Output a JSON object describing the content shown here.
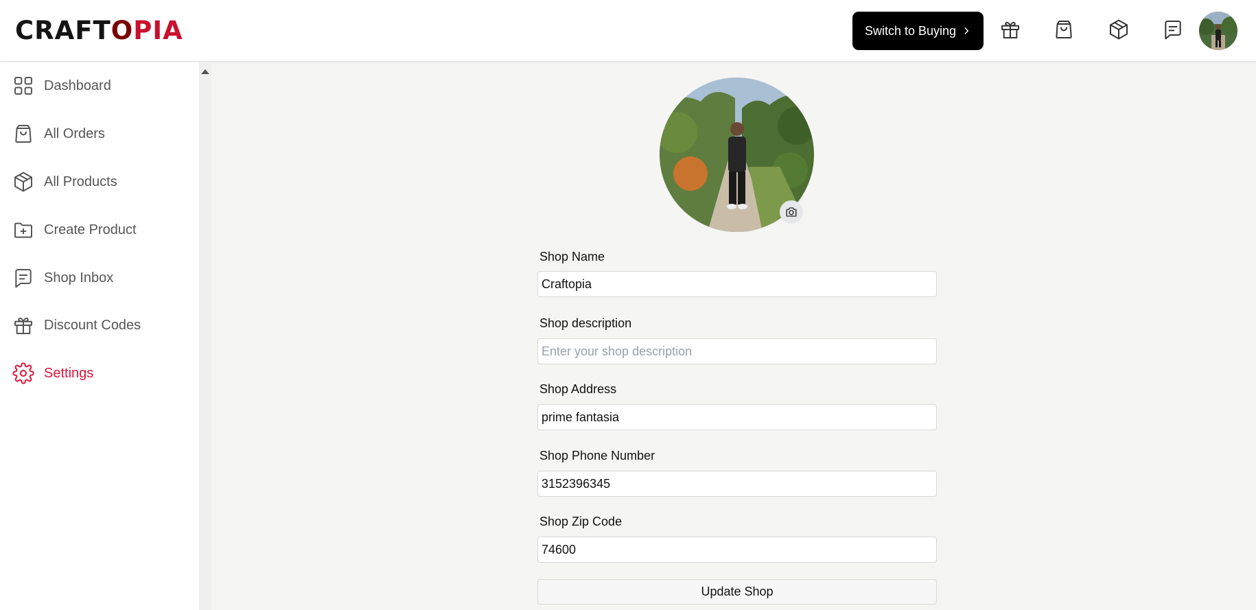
{
  "brand": {
    "logo_part1": "CRAFT",
    "logo_part2": "O",
    "logo_part3": "PIA"
  },
  "header": {
    "switch_label": "Switch to Buying",
    "icons": [
      "gift-icon",
      "shopping-bag-icon",
      "package-icon",
      "message-icon"
    ]
  },
  "sidebar": {
    "items": [
      {
        "label": "Dashboard",
        "icon": "dashboard-icon"
      },
      {
        "label": "All Orders",
        "icon": "shopping-bag-icon"
      },
      {
        "label": "All Products",
        "icon": "package-icon"
      },
      {
        "label": "Create Product",
        "icon": "folder-plus-icon"
      },
      {
        "label": "Shop Inbox",
        "icon": "message-icon"
      },
      {
        "label": "Discount Codes",
        "icon": "gift-icon"
      },
      {
        "label": "Settings",
        "icon": "gear-icon",
        "active": true
      }
    ]
  },
  "form": {
    "shop_name_label": "Shop Name",
    "shop_name_value": "Craftopia",
    "description_label": "Shop description",
    "description_placeholder": "Enter your shop description",
    "description_value": "",
    "address_label": "Shop Address",
    "address_value": "prime fantasia",
    "phone_label": "Shop Phone Number",
    "phone_value": "3152396345",
    "zip_label": "Shop Zip Code",
    "zip_value": "74600",
    "submit_label": "Update Shop"
  },
  "colors": {
    "accent": "#dc143c",
    "logo_dark_red": "#7a0000",
    "button_black": "#000000"
  }
}
